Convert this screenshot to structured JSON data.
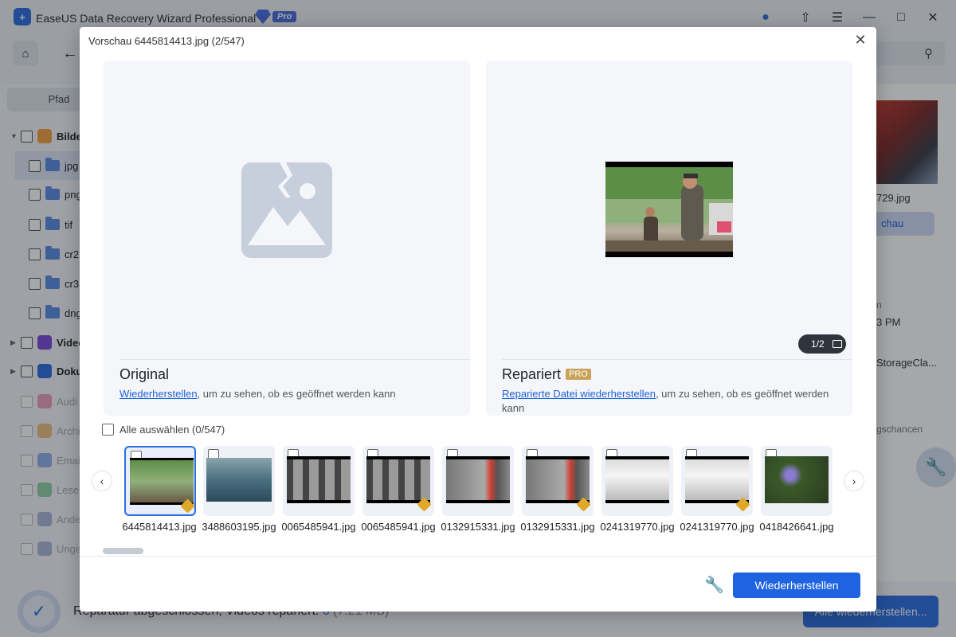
{
  "app": {
    "title": "EaseUS Data Recovery Wizard Professional",
    "pro_label": "Pro"
  },
  "sidebar": {
    "path_tab": "Pfad",
    "items": [
      {
        "label": "Bilder",
        "type": "category",
        "expanded": true
      },
      {
        "label": "jpg",
        "type": "folder",
        "selected": true
      },
      {
        "label": "png",
        "type": "folder"
      },
      {
        "label": "tif",
        "type": "folder"
      },
      {
        "label": "cr2",
        "type": "folder"
      },
      {
        "label": "cr3",
        "type": "folder"
      },
      {
        "label": "dng",
        "type": "folder"
      },
      {
        "label": "Video",
        "type": "category"
      },
      {
        "label": "Doku",
        "type": "category"
      },
      {
        "label": "Audi",
        "type": "category",
        "dim": true
      },
      {
        "label": "Archi",
        "type": "category",
        "dim": true
      },
      {
        "label": "Email",
        "type": "category",
        "dim": true
      },
      {
        "label": "Lesez",
        "type": "category",
        "dim": true
      },
      {
        "label": "Ande",
        "type": "category",
        "dim": true
      },
      {
        "label": "Unge",
        "type": "category",
        "dim": true
      }
    ]
  },
  "right_peek": {
    "filename": "729.jpg",
    "preview_btn": "chau",
    "text1": "n",
    "text2": "3 PM",
    "text3": "StorageCla...",
    "text4": "gschancen"
  },
  "bottombar": {
    "status_main": "Reparatur abgeschlossen, Videos repariert: ",
    "status_count": "6",
    "status_size": " (7.21 MB)",
    "recover_all": "Alle wiederherstellen..."
  },
  "modal": {
    "title": "Vorschau 6445814413.jpg (2/547)",
    "original": {
      "heading": "Original",
      "link": "Wiederherstellen",
      "desc": ", um zu sehen, ob es geöffnet werden kann"
    },
    "repaired": {
      "heading": "Repariert",
      "pro_tag": "PRO",
      "link": "Reparierte Datei wiederherstellen",
      "desc": ", um zu sehen, ob es geöffnet werden kann",
      "page": "1/2"
    },
    "select_all": "Alle auswählen (0/547)",
    "thumbnails": [
      {
        "name": "6445814413.jpg",
        "badge": true,
        "active": true
      },
      {
        "name": "3488603195.jpg",
        "badge": false
      },
      {
        "name": "0065485941.jpg",
        "badge": false
      },
      {
        "name": "0065485941.jpg",
        "badge": true
      },
      {
        "name": "0132915331.jpg",
        "badge": false
      },
      {
        "name": "0132915331.jpg",
        "badge": true
      },
      {
        "name": "0241319770.jpg",
        "badge": false
      },
      {
        "name": "0241319770.jpg",
        "badge": true
      },
      {
        "name": "0418426641.jpg",
        "badge": false
      }
    ],
    "restore_button": "Wiederherstellen"
  },
  "colors": {
    "accent": "#1f63e0",
    "pro_gold": "#c9a35a",
    "badge": "#e0a828"
  }
}
